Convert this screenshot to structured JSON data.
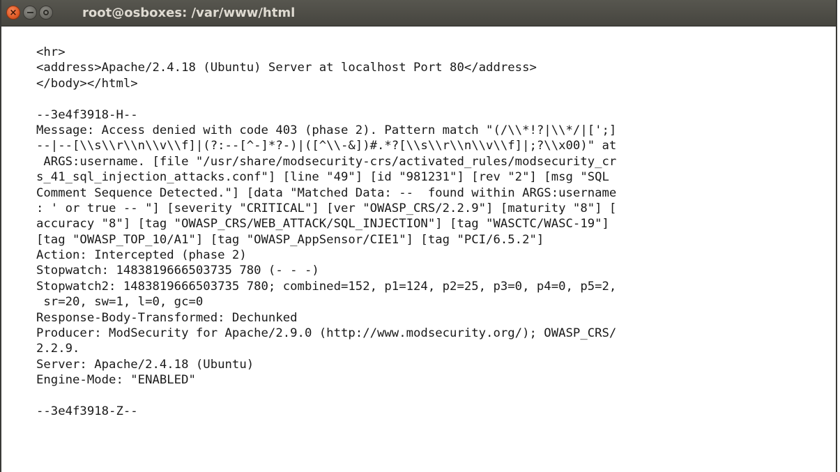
{
  "window": {
    "title": "root@osboxes: /var/www/html",
    "buttons": {
      "close_icon": "close-icon",
      "minimize_icon": "minimize-icon",
      "maximize_icon": "maximize-icon",
      "close_glyph": "×"
    }
  },
  "colors": {
    "titlebar": "#4e4d47",
    "close_button": "#e05a25",
    "title_text": "#dfdbd2",
    "terminal_background": "#ffffff",
    "terminal_text": "#1a1a1a"
  },
  "terminal": {
    "lines": [
      "<hr>",
      "<address>Apache/2.4.18 (Ubuntu) Server at localhost Port 80</address>",
      "</body></html>",
      "",
      "--3e4f3918-H--",
      "Message: Access denied with code 403 (phase 2). Pattern match \"(/\\\\*!?|\\\\*/|[';]",
      "--|--[\\\\s\\\\r\\\\n\\\\v\\\\f]|(?:--[^-]*?-)|([^\\\\-&])#.*?[\\\\s\\\\r\\\\n\\\\v\\\\f]|;?\\\\x00)\" at",
      " ARGS:username. [file \"/usr/share/modsecurity-crs/activated_rules/modsecurity_cr",
      "s_41_sql_injection_attacks.conf\"] [line \"49\"] [id \"981231\"] [rev \"2\"] [msg \"SQL",
      "Comment Sequence Detected.\"] [data \"Matched Data: --  found within ARGS:username",
      ": ' or true -- \"] [severity \"CRITICAL\"] [ver \"OWASP_CRS/2.2.9\"] [maturity \"8\"] [",
      "accuracy \"8\"] [tag \"OWASP_CRS/WEB_ATTACK/SQL_INJECTION\"] [tag \"WASCTC/WASC-19\"]",
      "[tag \"OWASP_TOP_10/A1\"] [tag \"OWASP_AppSensor/CIE1\"] [tag \"PCI/6.5.2\"]",
      "Action: Intercepted (phase 2)",
      "Stopwatch: 1483819666503735 780 (- - -)",
      "Stopwatch2: 1483819666503735 780; combined=152, p1=124, p2=25, p3=0, p4=0, p5=2,",
      " sr=20, sw=1, l=0, gc=0",
      "Response-Body-Transformed: Dechunked",
      "Producer: ModSecurity for Apache/2.9.0 (http://www.modsecurity.org/); OWASP_CRS/",
      "2.2.9.",
      "Server: Apache/2.4.18 (Ubuntu)",
      "Engine-Mode: \"ENABLED\"",
      "",
      "--3e4f3918-Z--"
    ]
  }
}
